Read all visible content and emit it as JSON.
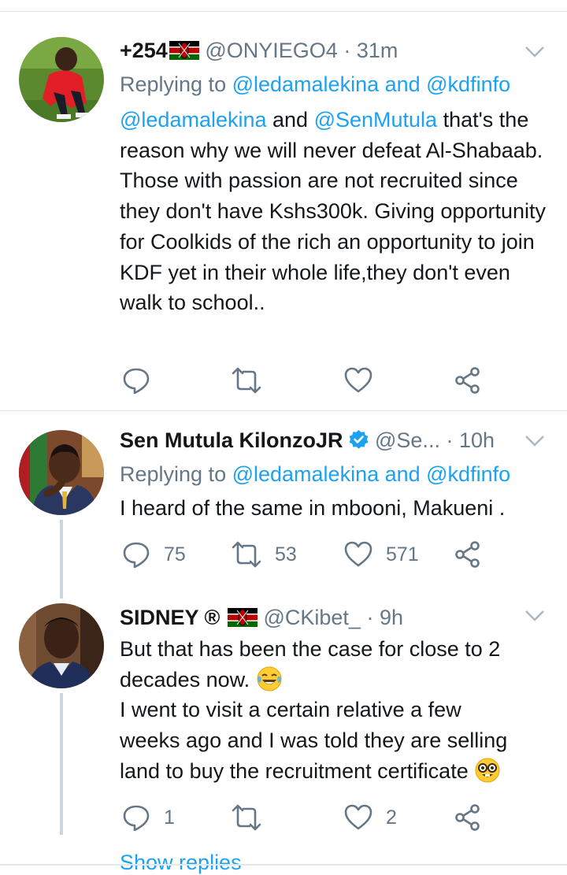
{
  "tweets": [
    {
      "name": "+254",
      "handle": "@ONYIEGO4",
      "time": "31m",
      "replying_prefix": "Replying to ",
      "replying_to": "@ledamalekina and @kdfinfo",
      "body_mentions": [
        "@ledamalekina",
        "@SenMutula"
      ],
      "body_and": " and ",
      "body_first_line_rest": " that's",
      "body_rest": "the reason why we will never defeat Al-Shabaab. Those with passion are not recruited since they don't have Kshs300k. Giving opportunity for Coolkids of the rich an opportunity to join KDF yet in their whole life,they don't even walk to school..",
      "reply_count": "",
      "retweet_count": "",
      "like_count": ""
    },
    {
      "name": "Sen Mutula KilonzoJR",
      "handle": "@Se...",
      "time": "10h",
      "replying_prefix": "Replying to ",
      "replying_to": "@ledamalekina and @kdfinfo",
      "body": "I heard of  the same in mbooni, Makueni .",
      "reply_count": "75",
      "retweet_count": "53",
      "like_count": "571"
    },
    {
      "name": "SIDNEY ®",
      "handle": "@CKibet_",
      "time": "9h",
      "body_line1": "But that has been the case for close to 2",
      "body_line2": "decades now.",
      "body_line3": "I went to visit a certain relative a few",
      "body_line4": "weeks ago and I was told they are selling",
      "body_line5": "land to buy the recruitment certificate",
      "reply_count": "1",
      "retweet_count": "",
      "like_count": "2"
    }
  ],
  "show_replies": "Show replies",
  "colors": {
    "link": "#1da1f2",
    "secondary": "#657786",
    "text": "#14171a",
    "divider": "#e1e8ed",
    "thread_line": "#ccd6dd",
    "verified": "#1da1f2"
  },
  "icons": [
    "kenya-flag-icon",
    "verified-badge-icon",
    "chevron-down-icon",
    "reply-icon",
    "retweet-icon",
    "like-icon",
    "share-icon",
    "tears-of-joy-emoji",
    "nerd-face-emoji"
  ]
}
